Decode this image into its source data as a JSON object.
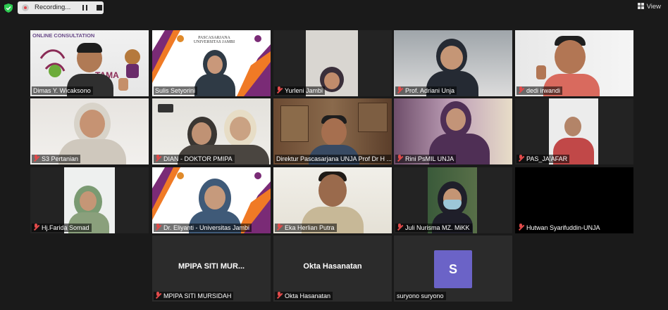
{
  "toolbar": {
    "recording_label": "Recording...",
    "view_label": "View"
  },
  "participants": [
    {
      "name": "Dimas Y. Wicaksono",
      "muted": false,
      "overlay_text": "ONLINE CONSULTATION"
    },
    {
      "name": "Sulis Setyorini",
      "muted": false,
      "slide_text": "PASCASARJANA\nUNIVERSITAS JAMBI"
    },
    {
      "name": "Yurleni Jambi",
      "muted": true
    },
    {
      "name": "Prof. Adriani Unja",
      "muted": true
    },
    {
      "name": "dedi irwandi",
      "muted": true
    },
    {
      "name": "S3 Pertanian",
      "muted": true
    },
    {
      "name": "DIAN - DOKTOR PMIPA",
      "muted": true
    },
    {
      "name": "Direktur Pascasarjana UNJA Prof Dr H ...",
      "muted": false
    },
    {
      "name": "Rini PsMIL UNJA",
      "muted": true
    },
    {
      "name": "PAS_JA'AFAR",
      "muted": true
    },
    {
      "name": "Hj.Farida Somad",
      "muted": true
    },
    {
      "name": "Dr. Eliyanti - Universitas Jambi",
      "muted": true
    },
    {
      "name": "Eka Herlian Putra",
      "muted": true
    },
    {
      "name": "Juli Nurisma MZ. MiKK",
      "muted": true
    },
    {
      "name": "Hutwan Syarifuddin-UNJA",
      "muted": true
    },
    {
      "name": "MPIPA SITI MURSIDAH",
      "muted": true,
      "display_name": "MPIPA SITI MUR..."
    },
    {
      "name": "Okta Hasanatan",
      "muted": true,
      "display_name": "Okta Hasanatan"
    },
    {
      "name": "suryono suryono",
      "muted": false,
      "avatar_letter": "S"
    }
  ],
  "colors": {
    "active_speaker": "#b9e24a",
    "avatar_bg": "#6b63c7",
    "muted_icon": "#e04a4a"
  }
}
